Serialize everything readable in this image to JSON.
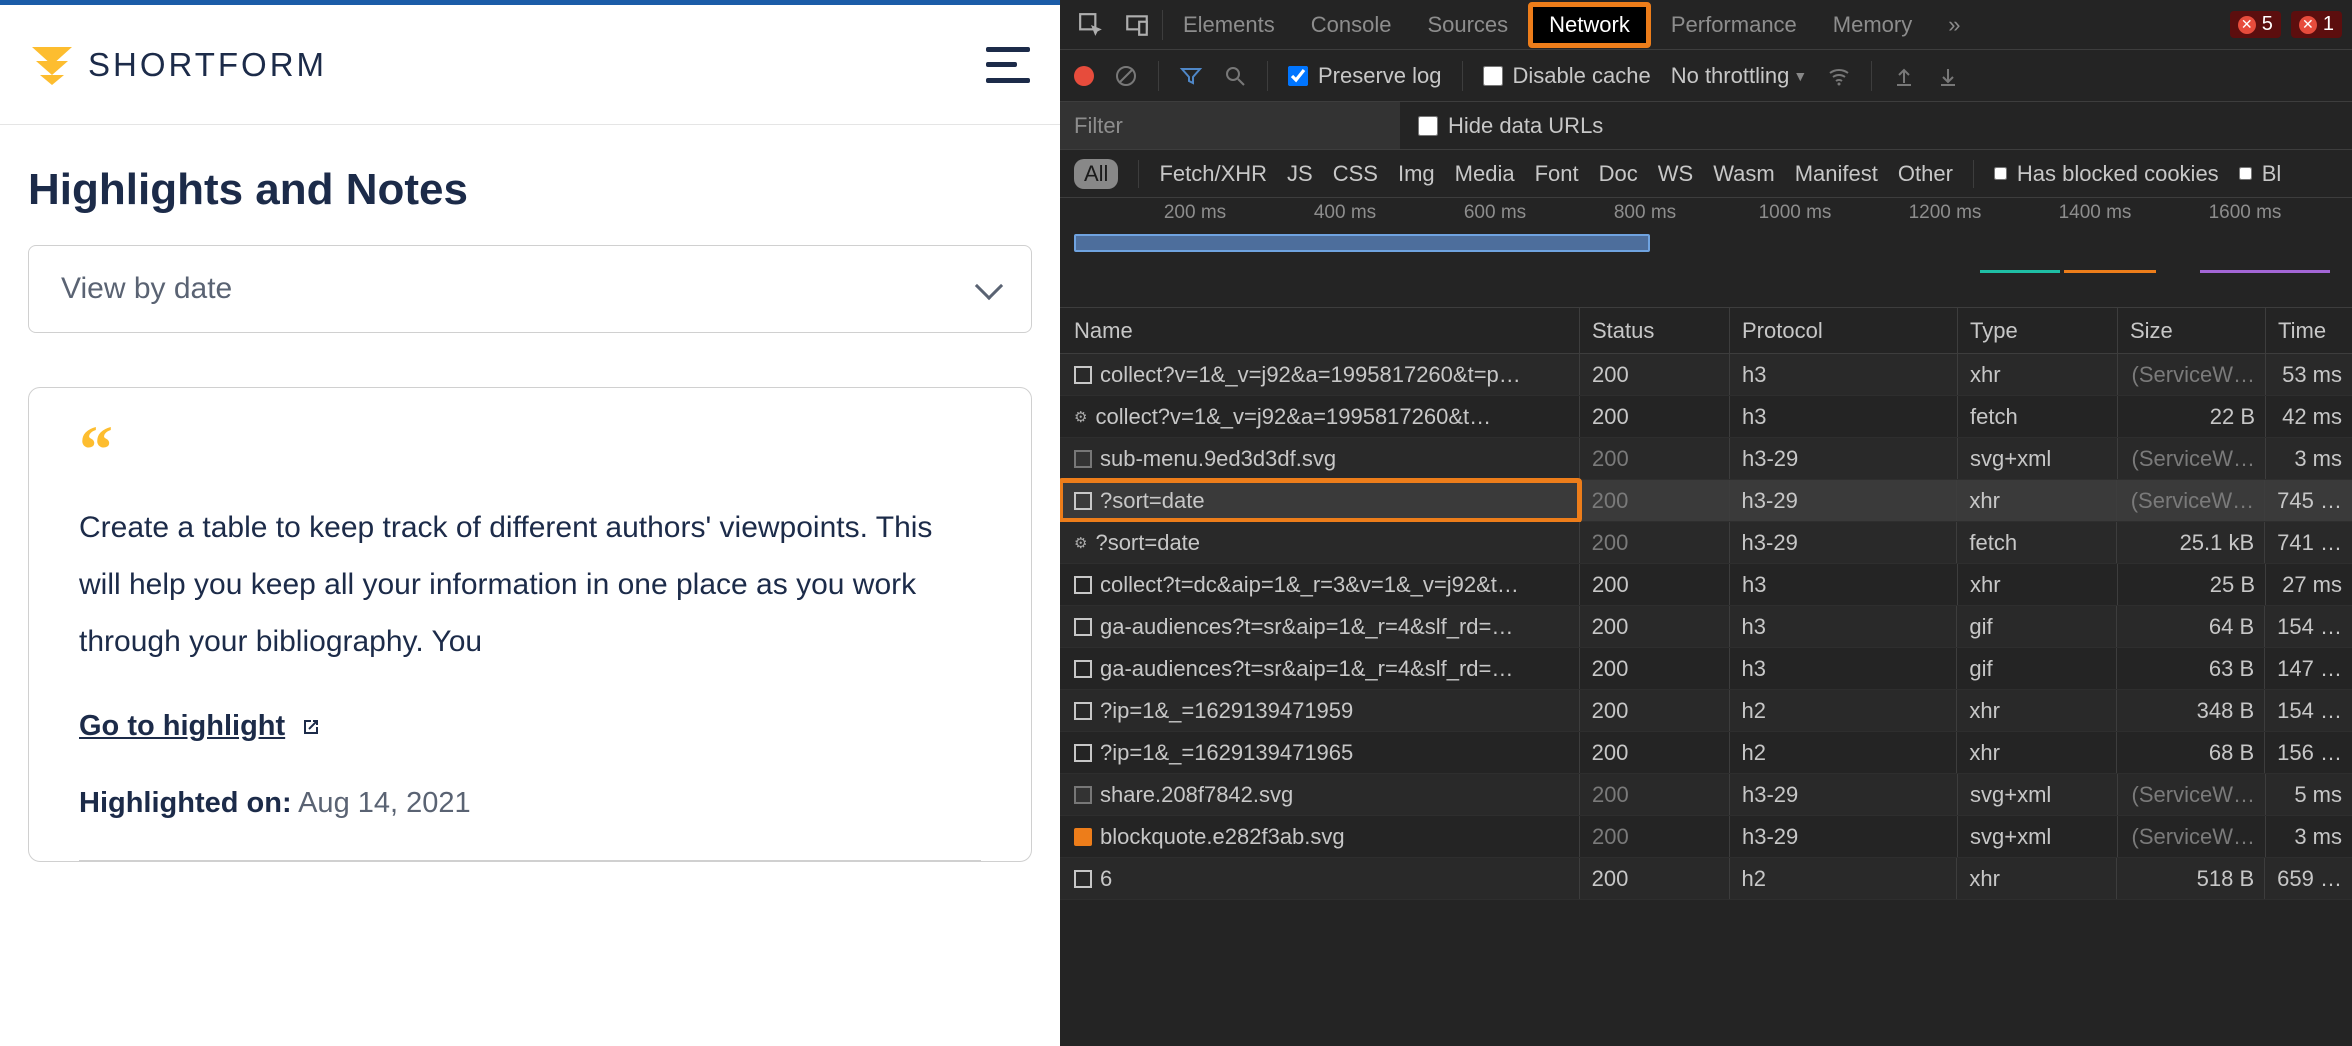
{
  "shortform": {
    "brand": "SHORTFORM",
    "title": "Highlights and Notes",
    "dropdown_label": "View by date",
    "card": {
      "body": "Create a table to keep track of different authors' viewpoints. This will help you keep all your information in one place as you work through your bibliography. You",
      "link_label": "Go to highlight",
      "meta_label": "Highlighted on:",
      "meta_date": "Aug 14, 2021"
    }
  },
  "devtools": {
    "tabs": [
      "Elements",
      "Console",
      "Sources",
      "Network",
      "Performance",
      "Memory"
    ],
    "active_tab": "Network",
    "error_count": "5",
    "error_count2": "1",
    "toolbar": {
      "preserve_log": "Preserve log",
      "disable_cache": "Disable cache",
      "throttling": "No throttling"
    },
    "filter_placeholder": "Filter",
    "hide_urls_label": "Hide data URLs",
    "types": [
      "All",
      "Fetch/XHR",
      "JS",
      "CSS",
      "Img",
      "Media",
      "Font",
      "Doc",
      "WS",
      "Wasm",
      "Manifest",
      "Other"
    ],
    "blocked_cookies": "Has blocked cookies",
    "blocked": "Bl",
    "timeline_ticks": [
      "200 ms",
      "400 ms",
      "600 ms",
      "800 ms",
      "1000 ms",
      "1200 ms",
      "1400 ms",
      "1600 ms"
    ],
    "columns": {
      "name": "Name",
      "status": "Status",
      "protocol": "Protocol",
      "type": "Type",
      "size": "Size",
      "time": "Time"
    },
    "rows": [
      {
        "name": "collect?v=1&_v=j92&a=1995817260&t=p…",
        "status": "200",
        "protocol": "h3",
        "type": "xhr",
        "size": "(ServiceW…",
        "time": "53 ms",
        "status_dim": false,
        "size_dim": true,
        "icon": "box"
      },
      {
        "name": "collect?v=1&_v=j92&a=1995817260&t…",
        "status": "200",
        "protocol": "h3",
        "type": "fetch",
        "size": "22 B",
        "time": "42 ms",
        "status_dim": false,
        "size_dim": false,
        "icon": "gear"
      },
      {
        "name": "sub-menu.9ed3d3df.svg",
        "status": "200",
        "protocol": "h3-29",
        "type": "svg+xml",
        "size": "(ServiceW…",
        "time": "3 ms",
        "status_dim": true,
        "size_dim": true,
        "icon": "svgf"
      },
      {
        "name": "?sort=date",
        "status": "200",
        "protocol": "h3-29",
        "type": "xhr",
        "size": "(ServiceW…",
        "time": "745 …",
        "status_dim": true,
        "size_dim": true,
        "icon": "box",
        "highlight": true
      },
      {
        "name": "?sort=date",
        "status": "200",
        "protocol": "h3-29",
        "type": "fetch",
        "size": "25.1 kB",
        "time": "741 …",
        "status_dim": true,
        "size_dim": false,
        "icon": "gear"
      },
      {
        "name": "collect?t=dc&aip=1&_r=3&v=1&_v=j92&t…",
        "status": "200",
        "protocol": "h3",
        "type": "xhr",
        "size": "25 B",
        "time": "27 ms",
        "status_dim": false,
        "size_dim": false,
        "icon": "box"
      },
      {
        "name": "ga-audiences?t=sr&aip=1&_r=4&slf_rd=…",
        "status": "200",
        "protocol": "h3",
        "type": "gif",
        "size": "64 B",
        "time": "154 …",
        "status_dim": false,
        "size_dim": false,
        "icon": "box"
      },
      {
        "name": "ga-audiences?t=sr&aip=1&_r=4&slf_rd=…",
        "status": "200",
        "protocol": "h3",
        "type": "gif",
        "size": "63 B",
        "time": "147 …",
        "status_dim": false,
        "size_dim": false,
        "icon": "box"
      },
      {
        "name": "?ip=1&_=1629139471959",
        "status": "200",
        "protocol": "h2",
        "type": "xhr",
        "size": "348 B",
        "time": "154 …",
        "status_dim": false,
        "size_dim": false,
        "icon": "box"
      },
      {
        "name": "?ip=1&_=1629139471965",
        "status": "200",
        "protocol": "h2",
        "type": "xhr",
        "size": "68 B",
        "time": "156 …",
        "status_dim": false,
        "size_dim": false,
        "icon": "box"
      },
      {
        "name": "share.208f7842.svg",
        "status": "200",
        "protocol": "h3-29",
        "type": "svg+xml",
        "size": "(ServiceW…",
        "time": "5 ms",
        "status_dim": true,
        "size_dim": true,
        "icon": "svgf"
      },
      {
        "name": "blockquote.e282f3ab.svg",
        "status": "200",
        "protocol": "h3-29",
        "type": "svg+xml",
        "size": "(ServiceW…",
        "time": "3 ms",
        "status_dim": true,
        "size_dim": true,
        "icon": "quote"
      },
      {
        "name": "6",
        "status": "200",
        "protocol": "h2",
        "type": "xhr",
        "size": "518 B",
        "time": "659 …",
        "status_dim": false,
        "size_dim": false,
        "icon": "box"
      }
    ]
  }
}
